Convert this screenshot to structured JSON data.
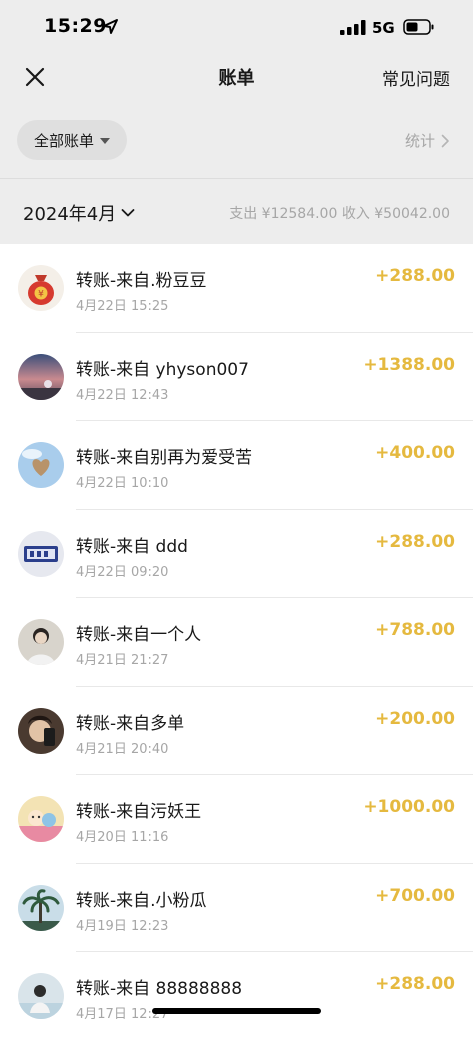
{
  "status_bar": {
    "time": "15:29",
    "network": "5G",
    "icons": [
      "location-arrow-icon",
      "signal-icon",
      "battery-icon"
    ]
  },
  "nav": {
    "title": "账单",
    "faq_label": "常见问题",
    "close_icon": "close-icon"
  },
  "filter": {
    "label": "全部账单",
    "stats_label": "统计"
  },
  "month": {
    "label": "2024年4月",
    "summary": "支出 ¥12584.00 收入 ¥50042.00"
  },
  "colors": {
    "amount": "#e5b93f",
    "header_bg": "#ededed",
    "muted_text": "#a6a6a6"
  },
  "transactions": [
    {
      "title": "转账-来自.粉豆豆",
      "time": "4月22日 15:25",
      "amount": "+288.00",
      "avatar": "money-bag-avatar"
    },
    {
      "title": "转账-来自 yhyson007",
      "time": "4月22日 12:43",
      "amount": "+1388.00",
      "avatar": "sunset-avatar"
    },
    {
      "title": "转账-来自别再为爱受苦",
      "time": "4月22日 10:10",
      "amount": "+400.00",
      "avatar": "heart-sky-avatar"
    },
    {
      "title": "转账-来自 ddd",
      "time": "4月22日 09:20",
      "amount": "+288.00",
      "avatar": "sticker-avatar"
    },
    {
      "title": "转账-来自一个人",
      "time": "4月21日 21:27",
      "amount": "+788.00",
      "avatar": "person-avatar"
    },
    {
      "title": "转账-来自多单",
      "time": "4月21日 20:40",
      "amount": "+200.00",
      "avatar": "selfie-avatar"
    },
    {
      "title": "转账-来自污妖王",
      "time": "4月20日 11:16",
      "amount": "+1000.00",
      "avatar": "cartoon-avatar"
    },
    {
      "title": "转账-来自.小粉瓜",
      "time": "4月19日 12:23",
      "amount": "+700.00",
      "avatar": "palm-tree-avatar"
    },
    {
      "title": "转账-来自 88888888",
      "time": "4月17日 12:27",
      "amount": "+288.00",
      "avatar": "beach-avatar"
    }
  ]
}
